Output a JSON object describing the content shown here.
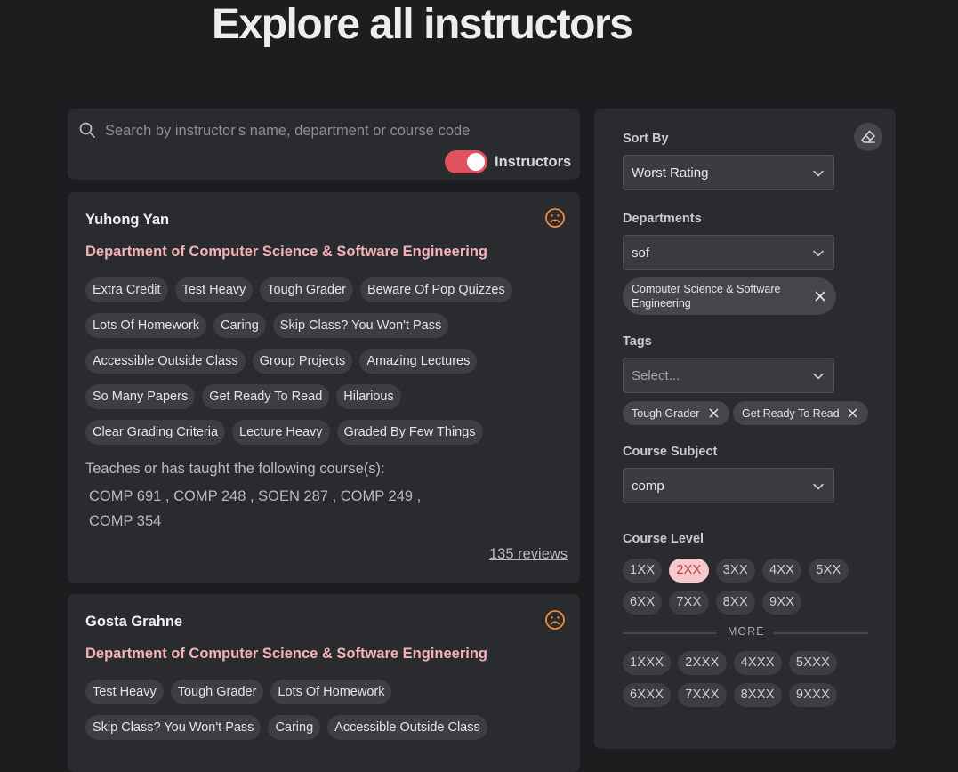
{
  "page": {
    "title": "Explore all instructors"
  },
  "search": {
    "placeholder": "Search by instructor's name, department or course code",
    "toggle_label": "Instructors",
    "toggle_on": true
  },
  "instructors": [
    {
      "name": "Yuhong Yan",
      "department": "Department of Computer Science & Software Engineering",
      "tags": [
        [
          "Extra Credit",
          "Test Heavy",
          "Tough Grader",
          "Beware Of Pop Quizzes"
        ],
        [
          "Lots Of Homework",
          "Caring",
          "Skip Class? You Won't Pass"
        ],
        [
          "Accessible Outside Class",
          "Group Projects",
          "Amazing Lectures"
        ],
        [
          "So Many Papers",
          "Get Ready To Read",
          "Hilarious"
        ],
        [
          "Clear Grading Criteria",
          "Lecture Heavy",
          "Graded By Few Things"
        ]
      ],
      "courses_intro": "Teaches or has taught the following course(s):",
      "courses_line1": "COMP 691 , COMP 248 , SOEN 287 , COMP 249 ,",
      "courses_line2": "COMP 354",
      "reviews": "135 reviews"
    },
    {
      "name": "Gosta Grahne",
      "department": "Department of Computer Science & Software Engineering",
      "tags": [
        [
          "Test Heavy",
          "Tough Grader",
          "Lots Of Homework"
        ],
        [
          "Skip Class? You Won't Pass",
          "Caring",
          "Accessible Outside Class"
        ]
      ]
    }
  ],
  "filters": {
    "sort_by": {
      "label": "Sort By",
      "value": "Worst Rating"
    },
    "departments": {
      "label": "Departments",
      "value": "sof",
      "selected": [
        "Computer Science & Software",
        "Engineering"
      ]
    },
    "tags": {
      "label": "Tags",
      "placeholder": "Select...",
      "selected": [
        "Tough Grader",
        "Get Ready To Read"
      ]
    },
    "course_subject": {
      "label": "Course Subject",
      "value": "comp"
    },
    "course_level": {
      "label": "Course Level",
      "row1": [
        "1XX",
        "2XX",
        "3XX",
        "4XX",
        "5XX"
      ],
      "row2": [
        "6XX",
        "7XX",
        "8XX",
        "9XX"
      ],
      "active": "2XX",
      "more_label": "MORE",
      "more_row1": [
        "1XXX",
        "2XXX",
        "4XXX",
        "5XXX"
      ],
      "more_row2": [
        "6XXX",
        "7XXX",
        "8XXX",
        "9XXX"
      ]
    }
  },
  "colors": {
    "background": "#1c1d1f",
    "panel": "#2a2b2e",
    "accent": "#e0525e",
    "department_text": "#f4b2b7",
    "warning_icon": "#f08a3c"
  },
  "icons": [
    "search-icon",
    "sad-face-icon",
    "eraser-icon",
    "chevron-down-icon",
    "close-icon"
  ]
}
